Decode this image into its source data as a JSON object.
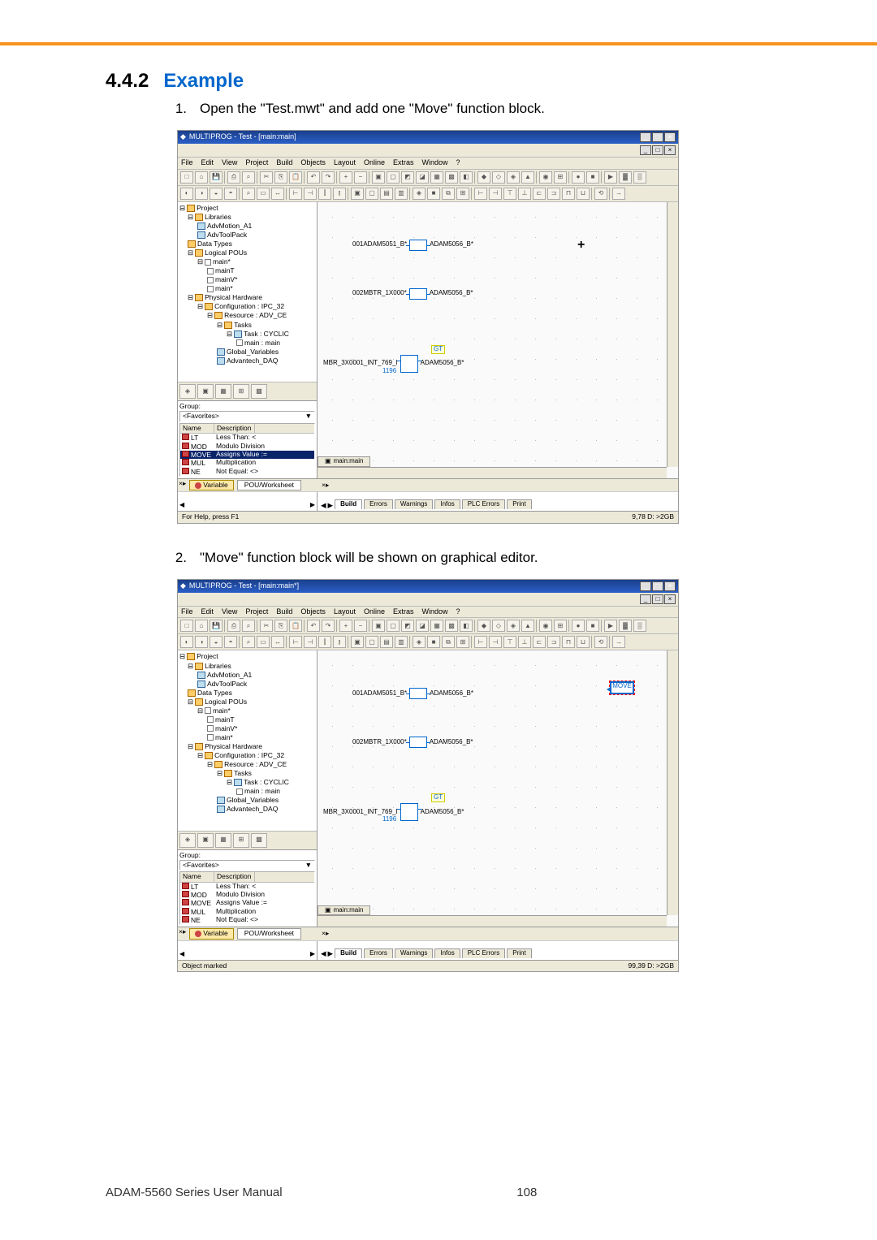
{
  "section": {
    "number": "4.4.2",
    "title": "Example"
  },
  "steps": [
    {
      "num": "1.",
      "text": "Open the \"Test.mwt\" and add one \"Move\" function block."
    },
    {
      "num": "2.",
      "text": "\"Move\" function block will be shown on graphical editor."
    }
  ],
  "app": {
    "title1": "MULTIPROG - Test - [main:main]",
    "title2": "MULTIPROG - Test - [main:main*]",
    "menus": [
      "File",
      "Edit",
      "View",
      "Project",
      "Build",
      "Objects",
      "Layout",
      "Online",
      "Extras",
      "Window",
      "?"
    ],
    "tree": {
      "root": "Project",
      "libraries": "Libraries",
      "lib1": "AdvMotion_A1",
      "lib2": "AdvToolPack",
      "dataTypes": "Data Types",
      "logicalPous": "Logical POUs",
      "main": "main*",
      "mainT": "mainT",
      "mainV": "mainV*",
      "main2": "main*",
      "physical": "Physical Hardware",
      "config": "Configuration : IPC_32",
      "resource": "Resource : ADV_CE",
      "tasks": "Tasks",
      "taskCyclic": "Task : CYCLIC",
      "mainMain": "main : main",
      "globalVars": "Global_Variables",
      "advDaq": "Advantech_DAQ"
    },
    "groupPanel": {
      "groupLabel": "Group:",
      "favorites": "<Favorites>",
      "colName": "Name",
      "colDesc": "Description",
      "items1": [
        {
          "n": "LT",
          "d": "Less Than: <"
        },
        {
          "n": "MOD",
          "d": "Modulo Division"
        },
        {
          "n": "MOVE",
          "d": "Assigns Value :="
        },
        {
          "n": "MUL",
          "d": "Multiplication"
        },
        {
          "n": "NE",
          "d": "Not Equal: <>"
        }
      ],
      "items2": [
        {
          "n": "LT",
          "d": "Less Than: <"
        },
        {
          "n": "MOD",
          "d": "Modulo Division"
        },
        {
          "n": "MOVE",
          "d": "Assigns Value :="
        },
        {
          "n": "MUL",
          "d": "Multiplication"
        },
        {
          "n": "NE",
          "d": "Not Equal: <>"
        }
      ]
    },
    "varBar": {
      "variable": "Variable",
      "pou": "POU/Worksheet"
    },
    "canvas": {
      "b1_in": "001ADAM5051_B*",
      "b1_out": "ADAM5056_B*",
      "b2_in": "002MBTR_1X000*",
      "b2_out": "ADAM5056_B*",
      "b3_in": "MBR_3X0001_INT_769_I",
      "b3_out": "ADAM5056_B*",
      "gt": "GT",
      "val": "1196",
      "move": "MOVE"
    },
    "wsTab": "main:main",
    "statusTabs": [
      "Build",
      "Errors",
      "Warnings",
      "Infos",
      "PLC Errors",
      "Print"
    ],
    "status1_left": "For Help, press F1",
    "status1_right": "9,78  D: >2GB",
    "status2_left": "Object marked",
    "status2_right": "99,39  D: >2GB"
  },
  "footer": {
    "left": "ADAM-5560 Series User Manual",
    "page": "108"
  }
}
